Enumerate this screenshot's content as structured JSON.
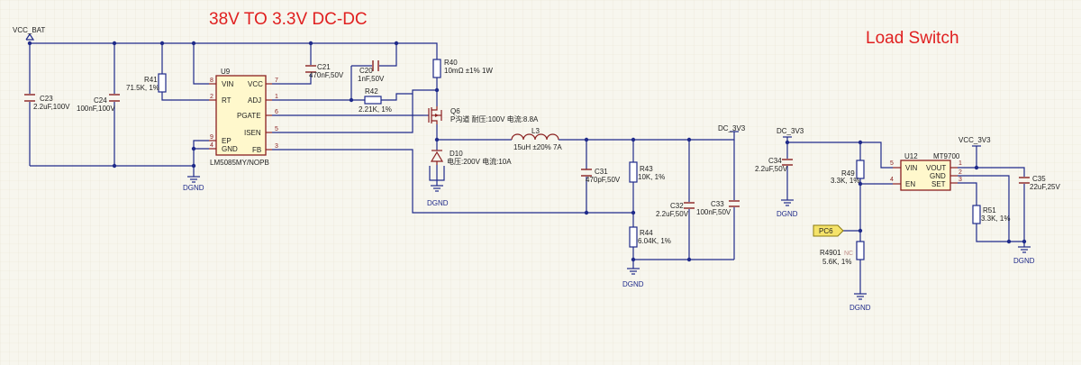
{
  "titles": {
    "dcdc": "38V TO 3.3V DC-DC",
    "load_switch": "Load Switch"
  },
  "nets": {
    "vcc_bat": "VCC_BAT",
    "dc_3v3_out": "DC_3V3",
    "dc_3v3_in": "DC_3V3",
    "vcc_3v3": "VCC_3V3",
    "pc6": "PC6",
    "dgnd": "DGND"
  },
  "u9": {
    "ref": "U9",
    "part": "LM5085MY/NOPB",
    "pins": {
      "vin": "VIN",
      "rt": "RT",
      "ep": "EP",
      "gnd": "GND",
      "vcc": "VCC",
      "adj": "ADJ",
      "pgate": "PGATE",
      "isen": "ISEN",
      "fb": "FB"
    },
    "pin_numbers": {
      "vin": "8",
      "rt": "2",
      "ep": "9",
      "gnd": "4",
      "vcc": "7",
      "adj": "1",
      "pgate": "6",
      "isen": "5",
      "fb": "3"
    }
  },
  "u12": {
    "ref": "U12",
    "part": "MT9700",
    "pins": {
      "vin": "VIN",
      "en": "EN",
      "vout": "VOUT",
      "gnd": "GND",
      "set": "SET"
    },
    "pin_numbers": {
      "vin": "5",
      "en": "4",
      "vout": "1",
      "gnd": "2",
      "set": "3"
    }
  },
  "components": {
    "c23": {
      "ref": "C23",
      "value": "2.2uF,100V"
    },
    "c24": {
      "ref": "C24",
      "value": "100nF,100V"
    },
    "r41": {
      "ref": "R41",
      "value": "71.5K, 1%"
    },
    "c21": {
      "ref": "C21",
      "value": "470nF,50V"
    },
    "c20": {
      "ref": "C20",
      "value": "1nF,50V"
    },
    "r42": {
      "ref": "R42",
      "value": "2.21K, 1%"
    },
    "r40": {
      "ref": "R40",
      "value": "10mΩ ±1% 1W"
    },
    "q6": {
      "ref": "Q6",
      "value": "P沟道 耐压:100V 电流:8.8A"
    },
    "d10": {
      "ref": "D10",
      "value": "电压:200V 电流:10A"
    },
    "l3": {
      "ref": "L3",
      "value": "15uH ±20% 7A"
    },
    "c31": {
      "ref": "C31",
      "value": "470pF,50V"
    },
    "r43": {
      "ref": "R43",
      "value": "10K, 1%"
    },
    "r44": {
      "ref": "R44",
      "value": "6.04K, 1%"
    },
    "c32": {
      "ref": "C32",
      "value": "2.2uF,50V"
    },
    "c33": {
      "ref": "C33",
      "value": "100nF,50V"
    },
    "c34": {
      "ref": "C34",
      "value": "2.2uF,50V"
    },
    "r49": {
      "ref": "R49",
      "value": "3.3K, 1%"
    },
    "r4901": {
      "ref": "R4901",
      "value": "5.6K, 1%",
      "note": "NC"
    },
    "r51": {
      "ref": "R51",
      "value": "3.3K, 1%"
    },
    "c35": {
      "ref": "C35",
      "value": "22uF,25V"
    }
  }
}
